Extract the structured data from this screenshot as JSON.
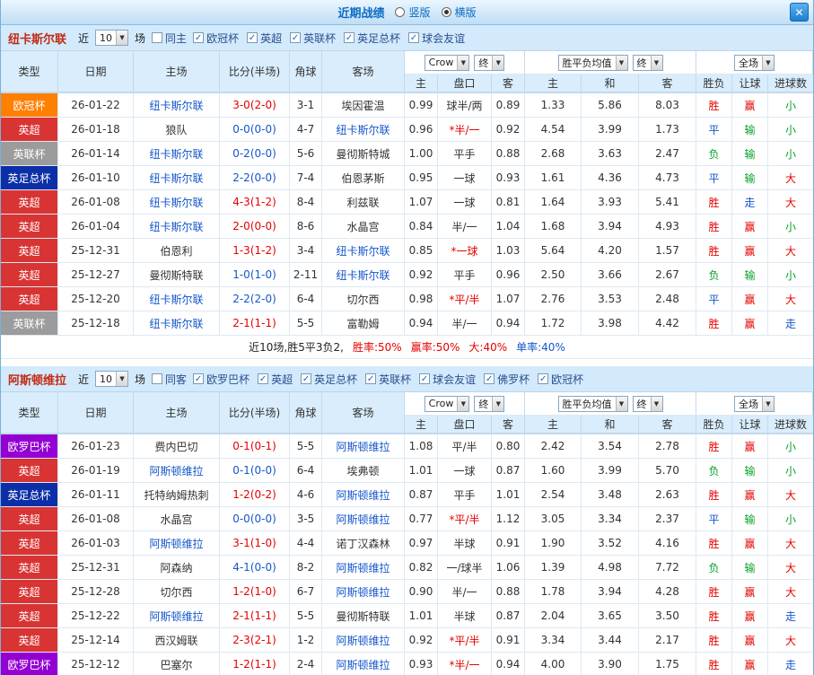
{
  "ui": {
    "title": "近期战绩",
    "layout_vertical": "竖版",
    "layout_horizontal": "横版",
    "selected_layout": "横版",
    "close": "✕",
    "near": "近",
    "games": "场"
  },
  "columns": {
    "type": "类型",
    "date": "日期",
    "home": "主场",
    "score": "比分(半场)",
    "corner": "角球",
    "away": "客场",
    "sub": [
      "主",
      "盘口",
      "客",
      "主",
      "和",
      "客",
      "胜负",
      "让球",
      "进球数"
    ]
  },
  "filters": {
    "company": "Crow",
    "final1": "终",
    "avg": "胜平负均值",
    "final2": "终",
    "scope": "全场"
  },
  "colors": {
    "accent_blue": "#1456cc",
    "win_red": "#e60000",
    "draw_blue": "#1456cc",
    "lose_green": "#0aa02a",
    "ucl_orange": "#ff7f00",
    "epl_red": "#d93434",
    "league_cup_gray": "#9c9c9c",
    "fa_cup_navy": "#0c2fa8",
    "uel_purple": "#9400d3"
  },
  "sections": [
    {
      "team": "纽卡斯尔联",
      "count": "10",
      "same_label": "同主",
      "cups": [
        {
          "label": "欧冠杯"
        },
        {
          "label": "英超"
        },
        {
          "label": "英联杯"
        },
        {
          "label": "英足总杯"
        },
        {
          "label": "球会友谊"
        }
      ],
      "rows": [
        {
          "type": "欧冠杯",
          "tk": "ucl",
          "date": "26-01-22",
          "home": "纽卡斯尔联",
          "hh": "t",
          "score": "3-0(2-0)",
          "sc": "r",
          "corners": "3-1",
          "away": "埃因霍温",
          "ah": "n",
          "odds_h": "0.99",
          "line": "球半/两",
          "lc": "k",
          "odds_a": "0.89",
          "win": "1.33",
          "draw": "5.86",
          "lose": "8.03",
          "res": "胜",
          "resc": "r",
          "cover": "赢",
          "coverc": "r",
          "goals": "小",
          "goalsc": "g"
        },
        {
          "type": "英超",
          "tk": "epl",
          "date": "26-01-18",
          "home": "狼队",
          "hh": "n",
          "score": "0-0(0-0)",
          "sc": "b",
          "corners": "4-7",
          "away": "纽卡斯尔联",
          "ah": "t",
          "odds_h": "0.96",
          "line": "*半/一",
          "lc": "r",
          "odds_a": "0.92",
          "win": "4.54",
          "draw": "3.99",
          "lose": "1.73",
          "res": "平",
          "resc": "b",
          "cover": "输",
          "coverc": "g",
          "goals": "小",
          "goalsc": "g"
        },
        {
          "type": "英联杯",
          "tk": "elc",
          "date": "26-01-14",
          "home": "纽卡斯尔联",
          "hh": "t",
          "score": "0-2(0-0)",
          "sc": "b",
          "corners": "5-6",
          "away": "曼彻斯特城",
          "ah": "n",
          "odds_h": "1.00",
          "line": "平手",
          "lc": "k",
          "odds_a": "0.88",
          "win": "2.68",
          "draw": "3.63",
          "lose": "2.47",
          "res": "负",
          "resc": "g",
          "cover": "输",
          "coverc": "g",
          "goals": "小",
          "goalsc": "g"
        },
        {
          "type": "英足总杯",
          "tk": "fac",
          "date": "26-01-10",
          "home": "纽卡斯尔联",
          "hh": "t",
          "score": "2-2(0-0)",
          "sc": "b",
          "corners": "7-4",
          "away": "伯恩茅斯",
          "ah": "n",
          "odds_h": "0.95",
          "line": "一球",
          "lc": "k",
          "odds_a": "0.93",
          "win": "1.61",
          "draw": "4.36",
          "lose": "4.73",
          "res": "平",
          "resc": "b",
          "cover": "输",
          "coverc": "g",
          "goals": "大",
          "goalsc": "r"
        },
        {
          "type": "英超",
          "tk": "epl",
          "date": "26-01-08",
          "home": "纽卡斯尔联",
          "hh": "t",
          "score": "4-3(1-2)",
          "sc": "r",
          "corners": "8-4",
          "away": "利兹联",
          "ah": "n",
          "odds_h": "1.07",
          "line": "一球",
          "lc": "k",
          "odds_a": "0.81",
          "win": "1.64",
          "draw": "3.93",
          "lose": "5.41",
          "res": "胜",
          "resc": "r",
          "cover": "走",
          "coverc": "b",
          "goals": "大",
          "goalsc": "r"
        },
        {
          "type": "英超",
          "tk": "epl",
          "date": "26-01-04",
          "home": "纽卡斯尔联",
          "hh": "t",
          "score": "2-0(0-0)",
          "sc": "r",
          "corners": "8-6",
          "away": "水晶宫",
          "ah": "n",
          "odds_h": "0.84",
          "line": "半/一",
          "lc": "k",
          "odds_a": "1.04",
          "win": "1.68",
          "draw": "3.94",
          "lose": "4.93",
          "res": "胜",
          "resc": "r",
          "cover": "赢",
          "coverc": "r",
          "goals": "小",
          "goalsc": "g"
        },
        {
          "type": "英超",
          "tk": "epl",
          "date": "25-12-31",
          "home": "伯恩利",
          "hh": "n",
          "score": "1-3(1-2)",
          "sc": "r",
          "corners": "3-4",
          "away": "纽卡斯尔联",
          "ah": "t",
          "odds_h": "0.85",
          "line": "*一球",
          "lc": "r",
          "odds_a": "1.03",
          "win": "5.64",
          "draw": "4.20",
          "lose": "1.57",
          "res": "胜",
          "resc": "r",
          "cover": "赢",
          "coverc": "r",
          "goals": "大",
          "goalsc": "r"
        },
        {
          "type": "英超",
          "tk": "epl",
          "date": "25-12-27",
          "home": "曼彻斯特联",
          "hh": "n",
          "score": "1-0(1-0)",
          "sc": "b",
          "corners": "2-11",
          "away": "纽卡斯尔联",
          "ah": "t",
          "odds_h": "0.92",
          "line": "平手",
          "lc": "k",
          "odds_a": "0.96",
          "win": "2.50",
          "draw": "3.66",
          "lose": "2.67",
          "res": "负",
          "resc": "g",
          "cover": "输",
          "coverc": "g",
          "goals": "小",
          "goalsc": "g"
        },
        {
          "type": "英超",
          "tk": "epl",
          "date": "25-12-20",
          "home": "纽卡斯尔联",
          "hh": "t",
          "score": "2-2(2-0)",
          "sc": "b",
          "corners": "6-4",
          "away": "切尔西",
          "ah": "n",
          "odds_h": "0.98",
          "line": "*平/半",
          "lc": "r",
          "odds_a": "1.07",
          "win": "2.76",
          "draw": "3.53",
          "lose": "2.48",
          "res": "平",
          "resc": "b",
          "cover": "赢",
          "coverc": "r",
          "goals": "大",
          "goalsc": "r"
        },
        {
          "type": "英联杯",
          "tk": "elc",
          "date": "25-12-18",
          "home": "纽卡斯尔联",
          "hh": "t",
          "score": "2-1(1-1)",
          "sc": "r",
          "corners": "5-5",
          "away": "富勒姆",
          "ah": "n",
          "odds_h": "0.94",
          "line": "半/一",
          "lc": "k",
          "odds_a": "0.94",
          "win": "1.72",
          "draw": "3.98",
          "lose": "4.42",
          "res": "胜",
          "resc": "r",
          "cover": "赢",
          "coverc": "r",
          "goals": "走",
          "goalsc": "b"
        }
      ],
      "summary": {
        "prefix": "近10场,胜5平3负2,",
        "win_rate": "胜率:50%",
        "cover_rate": "赢率:50%",
        "over_rate": "大:40%",
        "odd_rate": "单率:40%"
      }
    },
    {
      "team": "阿斯顿维拉",
      "count": "10",
      "same_label": "同客",
      "cups": [
        {
          "label": "欧罗巴杯"
        },
        {
          "label": "英超"
        },
        {
          "label": "英足总杯"
        },
        {
          "label": "英联杯"
        },
        {
          "label": "球会友谊"
        },
        {
          "label": "佛罗杯"
        },
        {
          "label": "欧冠杯"
        }
      ],
      "rows": [
        {
          "type": "欧罗巴杯",
          "tk": "uel",
          "date": "26-01-23",
          "home": "费内巴切",
          "hh": "n",
          "score": "0-1(0-1)",
          "sc": "r",
          "corners": "5-5",
          "away": "阿斯顿维拉",
          "ah": "t",
          "odds_h": "1.08",
          "line": "平/半",
          "lc": "k",
          "odds_a": "0.80",
          "win": "2.42",
          "draw": "3.54",
          "lose": "2.78",
          "res": "胜",
          "resc": "r",
          "cover": "赢",
          "coverc": "r",
          "goals": "小",
          "goalsc": "g"
        },
        {
          "type": "英超",
          "tk": "epl",
          "date": "26-01-19",
          "home": "阿斯顿维拉",
          "hh": "t",
          "score": "0-1(0-0)",
          "sc": "b",
          "corners": "6-4",
          "away": "埃弗顿",
          "ah": "n",
          "odds_h": "1.01",
          "line": "一球",
          "lc": "k",
          "odds_a": "0.87",
          "win": "1.60",
          "draw": "3.99",
          "lose": "5.70",
          "res": "负",
          "resc": "g",
          "cover": "输",
          "coverc": "g",
          "goals": "小",
          "goalsc": "g"
        },
        {
          "type": "英足总杯",
          "tk": "fac",
          "date": "26-01-11",
          "home": "托特纳姆热刺",
          "hh": "n",
          "score": "1-2(0-2)",
          "sc": "r",
          "corners": "4-6",
          "away": "阿斯顿维拉",
          "ah": "t",
          "odds_h": "0.87",
          "line": "平手",
          "lc": "k",
          "odds_a": "1.01",
          "win": "2.54",
          "draw": "3.48",
          "lose": "2.63",
          "res": "胜",
          "resc": "r",
          "cover": "赢",
          "coverc": "r",
          "goals": "大",
          "goalsc": "r"
        },
        {
          "type": "英超",
          "tk": "epl",
          "date": "26-01-08",
          "home": "水晶宫",
          "hh": "n",
          "score": "0-0(0-0)",
          "sc": "b",
          "corners": "3-5",
          "away": "阿斯顿维拉",
          "ah": "t",
          "odds_h": "0.77",
          "line": "*平/半",
          "lc": "r",
          "odds_a": "1.12",
          "win": "3.05",
          "draw": "3.34",
          "lose": "2.37",
          "res": "平",
          "resc": "b",
          "cover": "输",
          "coverc": "g",
          "goals": "小",
          "goalsc": "g"
        },
        {
          "type": "英超",
          "tk": "epl",
          "date": "26-01-03",
          "home": "阿斯顿维拉",
          "hh": "t",
          "score": "3-1(1-0)",
          "sc": "r",
          "corners": "4-4",
          "away": "诺丁汉森林",
          "ah": "n",
          "odds_h": "0.97",
          "line": "半球",
          "lc": "k",
          "odds_a": "0.91",
          "win": "1.90",
          "draw": "3.52",
          "lose": "4.16",
          "res": "胜",
          "resc": "r",
          "cover": "赢",
          "coverc": "r",
          "goals": "大",
          "goalsc": "r"
        },
        {
          "type": "英超",
          "tk": "epl",
          "date": "25-12-31",
          "home": "阿森纳",
          "hh": "n",
          "score": "4-1(0-0)",
          "sc": "b",
          "corners": "8-2",
          "away": "阿斯顿维拉",
          "ah": "t",
          "odds_h": "0.82",
          "line": "一/球半",
          "lc": "k",
          "odds_a": "1.06",
          "win": "1.39",
          "draw": "4.98",
          "lose": "7.72",
          "res": "负",
          "resc": "g",
          "cover": "输",
          "coverc": "g",
          "goals": "大",
          "goalsc": "r"
        },
        {
          "type": "英超",
          "tk": "epl",
          "date": "25-12-28",
          "home": "切尔西",
          "hh": "n",
          "score": "1-2(1-0)",
          "sc": "r",
          "corners": "6-7",
          "away": "阿斯顿维拉",
          "ah": "t",
          "odds_h": "0.90",
          "line": "半/一",
          "lc": "k",
          "odds_a": "0.88",
          "win": "1.78",
          "draw": "3.94",
          "lose": "4.28",
          "res": "胜",
          "resc": "r",
          "cover": "赢",
          "coverc": "r",
          "goals": "大",
          "goalsc": "r"
        },
        {
          "type": "英超",
          "tk": "epl",
          "date": "25-12-22",
          "home": "阿斯顿维拉",
          "hh": "t",
          "score": "2-1(1-1)",
          "sc": "r",
          "corners": "5-5",
          "away": "曼彻斯特联",
          "ah": "n",
          "odds_h": "1.01",
          "line": "半球",
          "lc": "k",
          "odds_a": "0.87",
          "win": "2.04",
          "draw": "3.65",
          "lose": "3.50",
          "res": "胜",
          "resc": "r",
          "cover": "赢",
          "coverc": "r",
          "goals": "走",
          "goalsc": "b"
        },
        {
          "type": "英超",
          "tk": "epl",
          "date": "25-12-14",
          "home": "西汉姆联",
          "hh": "n",
          "score": "2-3(2-1)",
          "sc": "r",
          "corners": "1-2",
          "away": "阿斯顿维拉",
          "ah": "t",
          "odds_h": "0.92",
          "line": "*平/半",
          "lc": "r",
          "odds_a": "0.91",
          "win": "3.34",
          "draw": "3.44",
          "lose": "2.17",
          "res": "胜",
          "resc": "r",
          "cover": "赢",
          "coverc": "r",
          "goals": "大",
          "goalsc": "r"
        },
        {
          "type": "欧罗巴杯",
          "tk": "uel",
          "date": "25-12-12",
          "home": "巴塞尔",
          "hh": "n",
          "score": "1-2(1-1)",
          "sc": "r",
          "corners": "2-4",
          "away": "阿斯顿维拉",
          "ah": "t",
          "odds_h": "0.93",
          "line": "*半/一",
          "lc": "r",
          "odds_a": "0.94",
          "win": "4.00",
          "draw": "3.90",
          "lose": "1.75",
          "res": "胜",
          "resc": "r",
          "cover": "赢",
          "coverc": "r",
          "goals": "走",
          "goalsc": "b"
        }
      ]
    }
  ]
}
